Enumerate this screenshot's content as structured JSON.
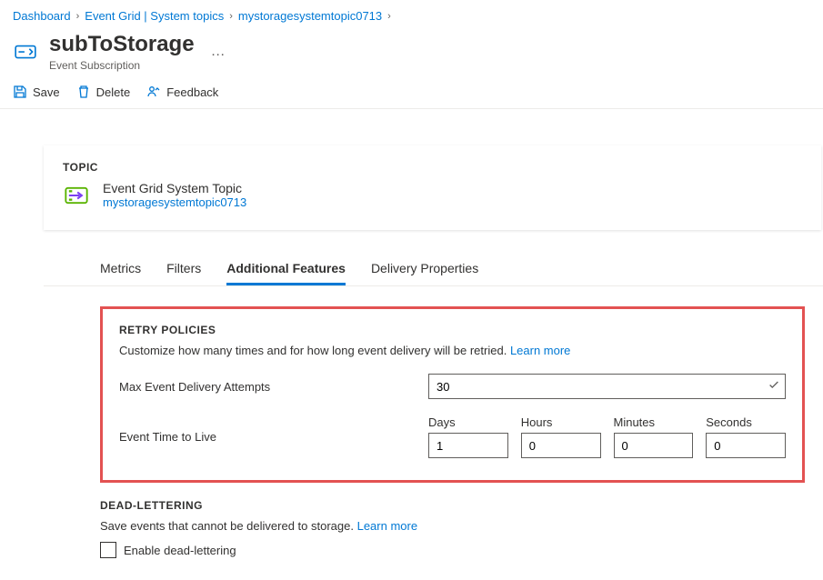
{
  "breadcrumbs": {
    "items": [
      "Dashboard",
      "Event Grid | System topics",
      "mystoragesystemtopic0713"
    ]
  },
  "header": {
    "title": "subToStorage",
    "subtitle": "Event Subscription"
  },
  "toolbar": {
    "save": "Save",
    "delete": "Delete",
    "feedback": "Feedback"
  },
  "topic": {
    "label": "TOPIC",
    "type": "Event Grid System Topic",
    "name": "mystoragesystemtopic0713"
  },
  "tabs": {
    "items": [
      "Metrics",
      "Filters",
      "Additional Features",
      "Delivery Properties"
    ],
    "activeIndex": 2
  },
  "retry": {
    "title": "RETRY POLICIES",
    "desc": "Customize how many times and for how long event delivery will be retried.",
    "learn": "Learn more",
    "maxLabel": "Max Event Delivery Attempts",
    "maxValue": "30",
    "ttlLabel": "Event Time to Live",
    "daysLabel": "Days",
    "hoursLabel": "Hours",
    "minutesLabel": "Minutes",
    "secondsLabel": "Seconds",
    "days": "1",
    "hours": "0",
    "minutes": "0",
    "seconds": "0"
  },
  "dead": {
    "title": "DEAD-LETTERING",
    "desc": "Save events that cannot be delivered to storage.",
    "learn": "Learn more",
    "checkboxLabel": "Enable dead-lettering"
  }
}
